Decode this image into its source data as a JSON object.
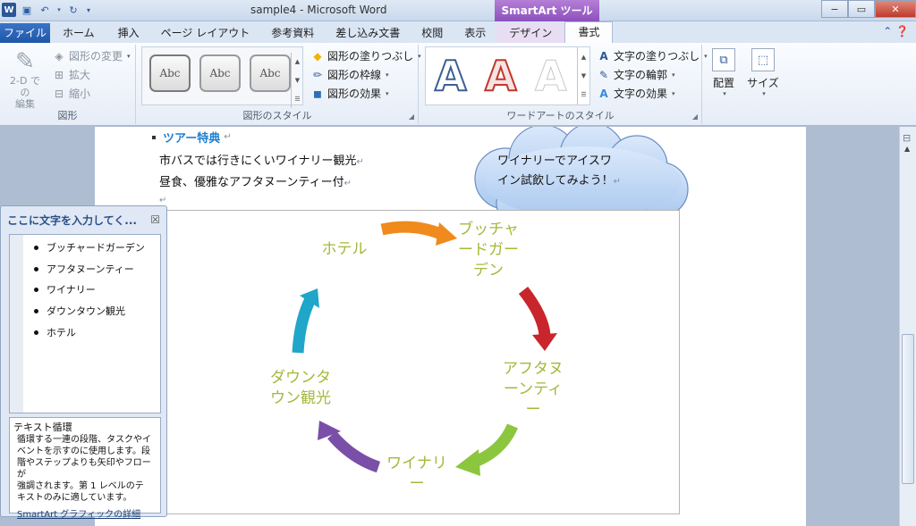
{
  "window": {
    "title": "sample4 - Microsoft Word",
    "contextual_tab_group": "SmartArt ツール",
    "minimize": "−",
    "restore": "▭",
    "close": "✕"
  },
  "tabs": [
    {
      "label": "ファイル"
    },
    {
      "label": "ホーム"
    },
    {
      "label": "挿入"
    },
    {
      "label": "ページ レイアウト"
    },
    {
      "label": "参考資料"
    },
    {
      "label": "差し込み文書"
    },
    {
      "label": "校閲"
    },
    {
      "label": "表示"
    },
    {
      "label": "デザイン"
    },
    {
      "label": "書式"
    }
  ],
  "ribbon": {
    "shape_group": {
      "label": "図形",
      "two_d_line1": "2-D での",
      "two_d_line2": "編集",
      "change_shape": "図形の変更",
      "enlarge": "拡大",
      "shrink": "縮小"
    },
    "shape_styles": {
      "label": "図形のスタイル",
      "swatch_text": "Abc",
      "fill": "図形の塗りつぶし",
      "outline": "図形の枠線",
      "effects": "図形の効果"
    },
    "wordart_styles": {
      "label": "ワードアートのスタイル",
      "letter": "A",
      "text_fill": "文字の塗りつぶし",
      "text_outline": "文字の輪郭",
      "text_effects": "文字の効果"
    },
    "arrange": "配置",
    "size": "サイズ"
  },
  "document": {
    "heading": "ツアー特典",
    "line1": "市バスでは行きにくいワイナリー観光",
    "line2": "昼食、優雅なアフタヌーンティー付",
    "para_mark": "↵",
    "callout_line1": "ワイナリーでアイスワ",
    "callout_line2": "イン試飲してみよう！"
  },
  "smartart": {
    "nodes": [
      {
        "line1": "ブッチャ",
        "line2": "ードガー",
        "line3": "デン"
      },
      {
        "line1": "アフタヌ",
        "line2": "ーンティ",
        "line3": "ー"
      },
      {
        "line1": "ワイナリ",
        "line2": "ー"
      },
      {
        "line1": "ダウンタ",
        "line2": "ウン観光"
      },
      {
        "line1": "ホテル"
      }
    ],
    "arrow_colors": [
      "#f08a1c",
      "#c8262c",
      "#8cc63e",
      "#7a4fa8",
      "#1fa6c9"
    ],
    "text_color": "#a4b83a"
  },
  "text_pane": {
    "title": "ここに文字を入力してく...",
    "close": "☒",
    "items": [
      "ブッチャードガーデン",
      "アフタヌーンティー",
      "ワイナリー",
      "ダウンタウン観光",
      "ホテル"
    ],
    "desc_title": "テキスト循環",
    "desc_lines": [
      "循環する一連の段階、タスクやイ",
      "ベントを示すのに使用します。段",
      "階やステップよりも矢印やフローが",
      "強調されます。第 1 レベルのテ",
      "キストのみに適しています。"
    ],
    "desc_link": "SmartArt グラフィックの詳細"
  }
}
